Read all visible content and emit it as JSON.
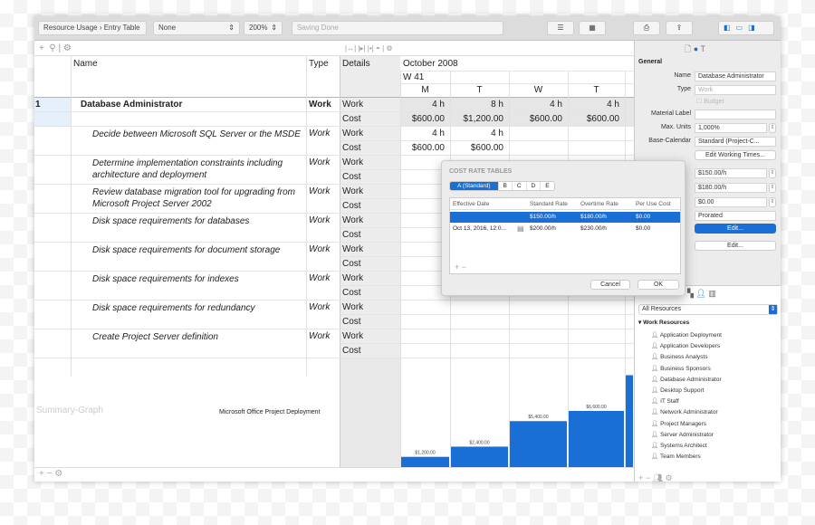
{
  "toolbar": {
    "breadcrumb": [
      "Resource Usage",
      "Entry Table"
    ],
    "filter": "None",
    "zoom": "200%",
    "status": "Saving Done"
  },
  "table": {
    "headers": {
      "name": "Name",
      "type": "Type",
      "details": "Details"
    },
    "timescale": {
      "month": "October 2008",
      "week": "W 41",
      "days": [
        "M",
        "T",
        "W",
        "T"
      ]
    },
    "resource": {
      "id": "1",
      "name": "Database Administrator",
      "type": "Work",
      "work": [
        "4 h",
        "8 h",
        "4 h",
        "4 h"
      ],
      "cost": [
        "$600.00",
        "$1,200.00",
        "$600.00",
        "$600.00"
      ]
    },
    "detail_labels": {
      "work": "Work",
      "cost": "Cost"
    },
    "tasks": [
      {
        "name": "Decide between Microsoft SQL Server or the MSDE",
        "type": "Work",
        "work": [
          "4 h",
          "4 h"
        ],
        "cost": [
          "$600.00",
          "$600.00"
        ]
      },
      {
        "name": "Determine implementation constraints including architecture and deployment",
        "type": "Work"
      },
      {
        "name": "Review database migration tool for upgrading from Microsoft Project Server 2002",
        "type": "Work"
      },
      {
        "name": "Disk space requirements for databases",
        "type": "Work"
      },
      {
        "name": "Disk space requirements for document storage",
        "type": "Work"
      },
      {
        "name": "Disk space requirements for indexes",
        "type": "Work"
      },
      {
        "name": "Disk space requirements for redundancy",
        "type": "Work"
      },
      {
        "name": "Create Project Server  definition",
        "type": "Work"
      }
    ]
  },
  "summary": {
    "label": "Summary-Graph",
    "project": "Microsoft Office Project  Deployment"
  },
  "chart_data": {
    "type": "bar",
    "categories": [
      "M",
      "T",
      "W",
      "T",
      ""
    ],
    "values": [
      1200,
      2400,
      5400,
      6600,
      10800
    ],
    "data_labels": [
      "$1,200.00",
      "$2,400.00",
      "$5,400.00",
      "$6,600.00",
      ""
    ],
    "color": "#1a6fd6"
  },
  "inspector": {
    "section": "General",
    "name_label": "Name",
    "name": "Database Administrator",
    "type_label": "Type",
    "type": "Work",
    "budget": "Budget",
    "material_label": "Material Label",
    "max_units_label": "Max. Units",
    "max_units": "1,000%",
    "calendar_label": "Base-Calendar",
    "calendar": "Standard (Project-C...",
    "edit_working_times": "Edit Working Times...",
    "std_rate": "$150.00/h",
    "ovt_rate": "$180.00/h",
    "per_use": "$0.00",
    "accrue": "Prorated",
    "edit1": "Edit...",
    "edit2": "Edit...",
    "label_e": "e",
    "label_e2": "e",
    "label_t": "t",
    "label_l": "l",
    "label_s": "s"
  },
  "resources": {
    "filter": "All Resources",
    "group": "Work Resources",
    "items": [
      "Application Deployment",
      "Application Developers",
      "Business Analysts",
      "Business Sponsors",
      "Database Administrator",
      "Desktop Support",
      "IT Staff",
      "Network Administrator",
      "Project Managers",
      "Server Administrator",
      "Systems Architect",
      "Team Members"
    ]
  },
  "dialog": {
    "title": "COST RATE TABLES",
    "tabs": [
      "A (Standard)",
      "B",
      "C",
      "D",
      "E"
    ],
    "columns": [
      "Effective Date",
      "Standard Rate",
      "Overtime Rate",
      "Per Use Cost"
    ],
    "rows": [
      [
        "",
        "$150.00/h",
        "$180.00/h",
        "$0.00"
      ],
      [
        "Oct 13, 2016, 12:0...",
        "$200.00/h",
        "$230.00/h",
        "$0.00"
      ]
    ],
    "cancel": "Cancel",
    "ok": "OK"
  },
  "accent": "#1a6fd6"
}
